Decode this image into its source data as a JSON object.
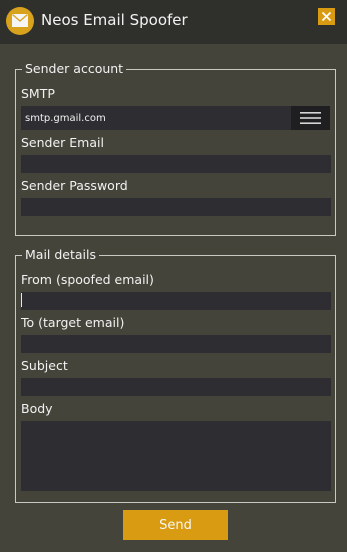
{
  "window": {
    "title": "Neos Email Spoofer"
  },
  "sender_account": {
    "legend": "Sender account",
    "smtp_label": "SMTP",
    "smtp_value": "smtp.gmail.com",
    "sender_email_label": "Sender Email",
    "sender_email_value": "",
    "sender_password_label": "Sender Password",
    "sender_password_value": ""
  },
  "mail_details": {
    "legend": "Mail details",
    "from_label": "From (spoofed email)",
    "from_value": "",
    "to_label": "To (target email)",
    "to_value": "",
    "subject_label": "Subject",
    "subject_value": "",
    "body_label": "Body",
    "body_value": ""
  },
  "actions": {
    "send_label": "Send"
  },
  "icons": {
    "app": "envelope-icon",
    "close": "close-icon",
    "smtp_menu": "hamburger-menu-icon"
  },
  "colors": {
    "background": "#45443a",
    "titlebar": "#2f2f2c",
    "accent": "#d99b12",
    "field": "#2d2d32"
  }
}
